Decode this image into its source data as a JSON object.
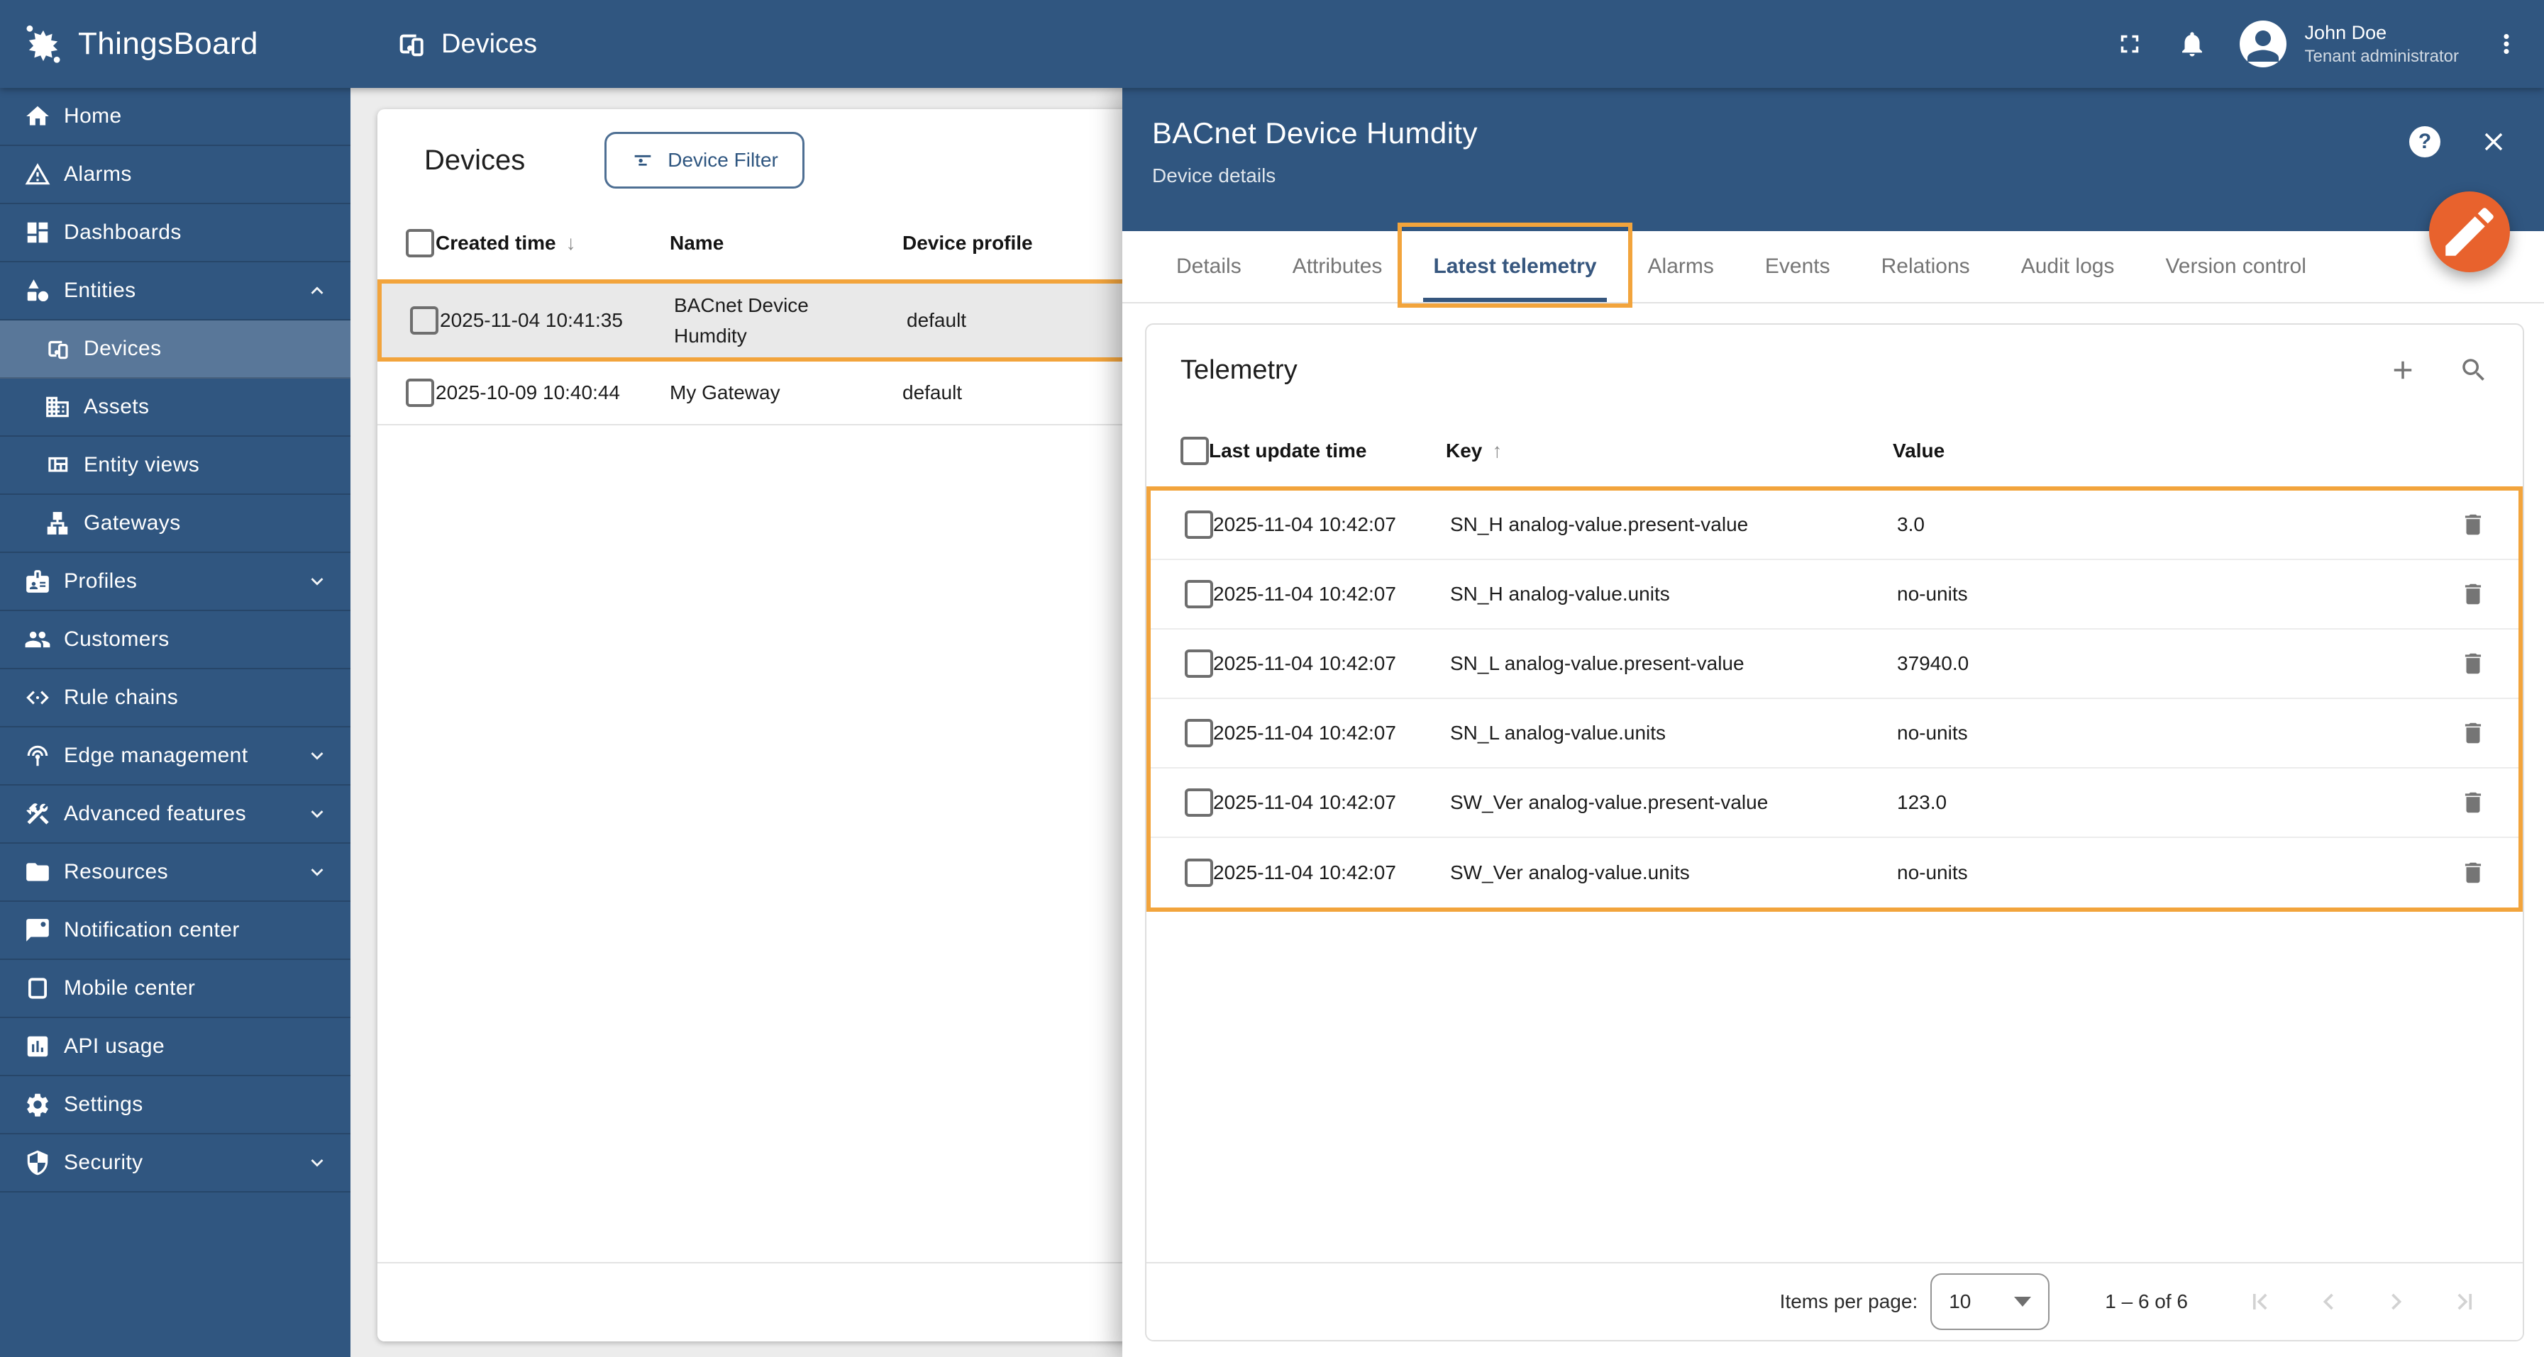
{
  "colors": {
    "primary": "#305680",
    "content_background": "#ececec",
    "highlight_orange": "#F2A43C",
    "fab_orange": "#E8622D",
    "active_tab_blue": "#36567E",
    "selected_row_background": "#e9e9e9"
  },
  "topbar": {
    "brand": "ThingsBoard",
    "page_title": "Devices",
    "user_name": "John Doe",
    "user_role": "Tenant administrator"
  },
  "sidebar": {
    "items": [
      {
        "label": "Home",
        "icon": "home-icon"
      },
      {
        "label": "Alarms",
        "icon": "alarm-warning-icon"
      },
      {
        "label": "Dashboards",
        "icon": "dashboards-icon"
      },
      {
        "label": "Entities",
        "icon": "entities-shapes-icon",
        "chevron": "up",
        "expanded": true
      },
      {
        "label": "Devices",
        "icon": "devices-icon",
        "indent": true,
        "selected": true
      },
      {
        "label": "Assets",
        "icon": "assets-building-icon",
        "indent": true
      },
      {
        "label": "Entity views",
        "icon": "entity-views-icon",
        "indent": true
      },
      {
        "label": "Gateways",
        "icon": "gateways-network-icon",
        "indent": true
      },
      {
        "label": "Profiles",
        "icon": "profiles-badge-icon",
        "chevron": "down"
      },
      {
        "label": "Customers",
        "icon": "customers-people-icon"
      },
      {
        "label": "Rule chains",
        "icon": "rule-chains-code-icon"
      },
      {
        "label": "Edge management",
        "icon": "edge-antenna-icon",
        "chevron": "down"
      },
      {
        "label": "Advanced features",
        "icon": "advanced-tools-icon",
        "chevron": "down"
      },
      {
        "label": "Resources",
        "icon": "resources-folder-icon",
        "chevron": "down"
      },
      {
        "label": "Notification center",
        "icon": "notification-bubble-icon"
      },
      {
        "label": "Mobile center",
        "icon": "mobile-icon"
      },
      {
        "label": "API usage",
        "icon": "api-usage-chart-icon"
      },
      {
        "label": "Settings",
        "icon": "settings-gear-icon"
      },
      {
        "label": "Security",
        "icon": "security-shield-icon",
        "chevron": "down"
      }
    ]
  },
  "devices_panel": {
    "title": "Devices",
    "filter_button_label": "Device Filter",
    "columns": [
      "Created time",
      "Name",
      "Device profile"
    ],
    "sort_column": "Created time",
    "sort_direction": "desc",
    "rows": [
      {
        "created_time": "2025-11-04 10:41:35",
        "name": "BACnet Device Humdity",
        "device_profile": "default",
        "highlighted": true
      },
      {
        "created_time": "2025-10-09 10:40:44",
        "name": "My Gateway",
        "device_profile": "default",
        "highlighted": false
      }
    ]
  },
  "drawer": {
    "title": "BACnet Device Humdity",
    "subtitle": "Device details",
    "help_label": "?",
    "tabs": [
      "Details",
      "Attributes",
      "Latest telemetry",
      "Alarms",
      "Events",
      "Relations",
      "Audit logs",
      "Version control"
    ],
    "active_tab": "Latest telemetry",
    "telemetry": {
      "title": "Telemetry",
      "columns": [
        "Last update time",
        "Key",
        "Value"
      ],
      "sort_column": "Key",
      "sort_direction": "asc",
      "rows": [
        {
          "last_update_time": "2025-11-04 10:42:07",
          "key": "SN_H analog-value.present-value",
          "value": "3.0"
        },
        {
          "last_update_time": "2025-11-04 10:42:07",
          "key": "SN_H analog-value.units",
          "value": "no-units"
        },
        {
          "last_update_time": "2025-11-04 10:42:07",
          "key": "SN_L analog-value.present-value",
          "value": "37940.0"
        },
        {
          "last_update_time": "2025-11-04 10:42:07",
          "key": "SN_L analog-value.units",
          "value": "no-units"
        },
        {
          "last_update_time": "2025-11-04 10:42:07",
          "key": "SW_Ver analog-value.present-value",
          "value": "123.0"
        },
        {
          "last_update_time": "2025-11-04 10:42:07",
          "key": "SW_Ver analog-value.units",
          "value": "no-units"
        }
      ]
    },
    "pagination": {
      "items_per_page_label": "Items per page:",
      "page_size": "10",
      "range_label": "1 – 6 of 6"
    }
  }
}
